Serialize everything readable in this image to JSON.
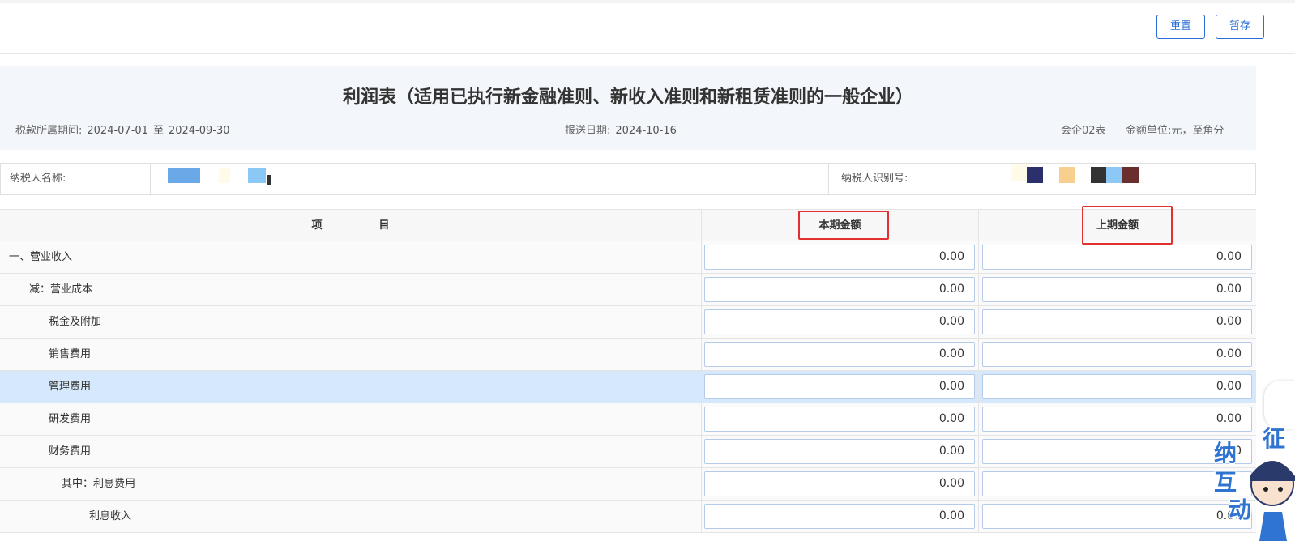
{
  "toolbar": {
    "reset_label": "重置",
    "save_draft_label": "暂存"
  },
  "report": {
    "title": "利润表（适用已执行新金融准则、新收入准则和新租赁准则的一般企业）",
    "period_label": "税款所属期间:",
    "period_start": "2024-07-01",
    "period_sep": "至",
    "period_end": "2024-09-30",
    "report_date_label": "报送日期:",
    "report_date": "2024-10-16",
    "form_code": "会企02表",
    "unit_label": "金额单位:",
    "unit_value": "元，至角分"
  },
  "taxpayer": {
    "name_label": "纳税人名称:",
    "id_label": "纳税人识别号:",
    "redaction_colors": [
      "#6aa8e8",
      "#8cc8f5",
      "#fffbe8",
      "#2b2f6b",
      "#f9cf8f",
      "#333333",
      "#6b2e2e"
    ]
  },
  "table": {
    "headers": {
      "item_a": "项",
      "item_b": "目",
      "current": "本期金额",
      "previous": "上期金额"
    },
    "rows": [
      {
        "label": "一、营业收入",
        "current": "0.00",
        "previous": "0.00",
        "selected": false
      },
      {
        "label": "减：营业成本",
        "current": "0.00",
        "previous": "0.00",
        "selected": false
      },
      {
        "label": "税金及附加",
        "current": "0.00",
        "previous": "0.00",
        "selected": false
      },
      {
        "label": "销售费用",
        "current": "0.00",
        "previous": "0.00",
        "selected": false
      },
      {
        "label": "管理费用",
        "current": "0.00",
        "previous": "0.00",
        "selected": true
      },
      {
        "label": "研发费用",
        "current": "0.00",
        "previous": "0.00",
        "selected": false
      },
      {
        "label": "财务费用",
        "current": "0.00",
        "previous": "0.00",
        "selected": false
      },
      {
        "label": "其中：利息费用",
        "current": "0.00",
        "previous": "",
        "selected": false
      },
      {
        "label": "利息收入",
        "current": "0.00",
        "previous": "0.00",
        "selected": false
      }
    ]
  },
  "mascot": {
    "chars": [
      "征",
      "纳",
      "互",
      "动"
    ]
  },
  "colors": {
    "accent": "#2b6fd6",
    "highlight_box": "#e03030",
    "selected_row": "#d6e8fb"
  }
}
